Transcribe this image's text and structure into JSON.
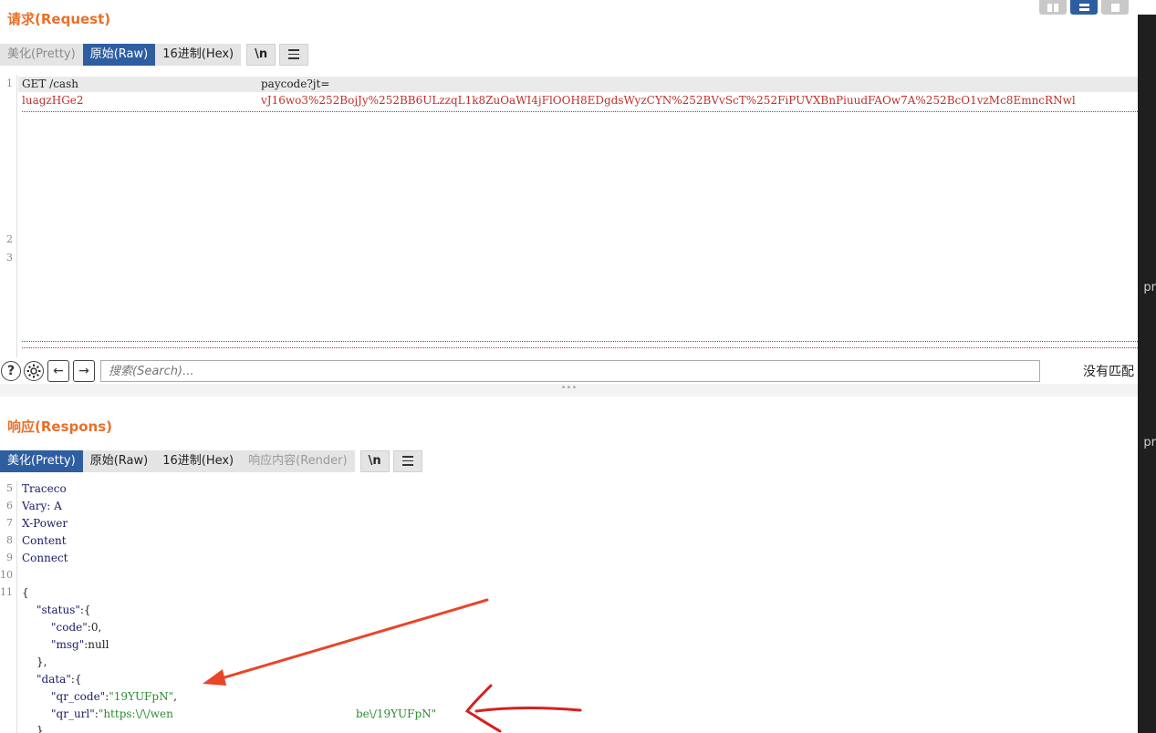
{
  "request": {
    "title": "请求(Request)",
    "tabs": [
      {
        "label": "美化(Pretty)",
        "state": "inactive"
      },
      {
        "label": "原始(Raw)",
        "state": "active"
      },
      {
        "label": "16进制(Hex)",
        "state": "plain"
      }
    ],
    "newline_btn": "\\n",
    "lines": [
      {
        "num": "1",
        "text_left": "GET /cash",
        "text_right": "paycode?jt="
      },
      {
        "num": "",
        "text_left": "luagzHGe2",
        "text_right": "vJ16wo3%252BojJy%252BB6ULzzqL1k8ZuOaWI4jFlOOH8EDgdsWyzCYN%252BVvScT%252FiPUVXBnPiuudFAOw7A%252BcO1vzMc8EmncRNwl"
      },
      {
        "num": "2",
        "text_left": "",
        "text_right": ""
      },
      {
        "num": "3",
        "text_left": "",
        "text_right": ""
      }
    ]
  },
  "search": {
    "placeholder": "搜索(Search)...",
    "status": "没有匹配",
    "help_icon": "?",
    "back_icon": "←",
    "forward_icon": "→"
  },
  "response": {
    "title": "响应(Respons)",
    "tabs": [
      {
        "label": "美化(Pretty)",
        "state": "active"
      },
      {
        "label": "原始(Raw)",
        "state": "plain"
      },
      {
        "label": "16进制(Hex)",
        "state": "plain"
      },
      {
        "label": "响应内容(Render)",
        "state": "muted"
      }
    ],
    "newline_btn": "\\n",
    "header_lines": [
      {
        "num": "5",
        "text": "Traceco"
      },
      {
        "num": "6",
        "text": "Vary: A"
      },
      {
        "num": "7",
        "text": "X-Power"
      },
      {
        "num": "8",
        "text": "Content"
      },
      {
        "num": "9",
        "text": "Connect"
      },
      {
        "num": "10",
        "text": ""
      },
      {
        "num": "11",
        "text": "{"
      }
    ],
    "json_lines": [
      {
        "indent": 1,
        "key": "\"status\"",
        "rest": ":{"
      },
      {
        "indent": 2,
        "key": "\"code\"",
        "rest": ":0,"
      },
      {
        "indent": 2,
        "key": "\"msg\"",
        "rest": ":null"
      },
      {
        "indent": 1,
        "key": "",
        "rest": "},"
      },
      {
        "indent": 1,
        "key": "\"data\"",
        "rest": ":{"
      },
      {
        "indent": 2,
        "key": "\"qr_code\"",
        "rest": ":",
        "value": "\"19YUFpN\"",
        "tail": ","
      },
      {
        "indent": 2,
        "key": "\"qr_url\"",
        "rest": ":",
        "value": "\"https:\\/\\/wen",
        "value2": "be\\/19YUFpN\"",
        "tail": ""
      },
      {
        "indent": 1,
        "key": "",
        "rest": "}"
      }
    ]
  },
  "side_strip": {
    "labels": [
      "pr",
      "pr"
    ]
  },
  "colors": {
    "accent": "#e8702a",
    "tab_active": "#2e5ea0",
    "code_red": "#c0302a",
    "json_string": "#2e8b30",
    "annotation_red": "#e8452a"
  }
}
